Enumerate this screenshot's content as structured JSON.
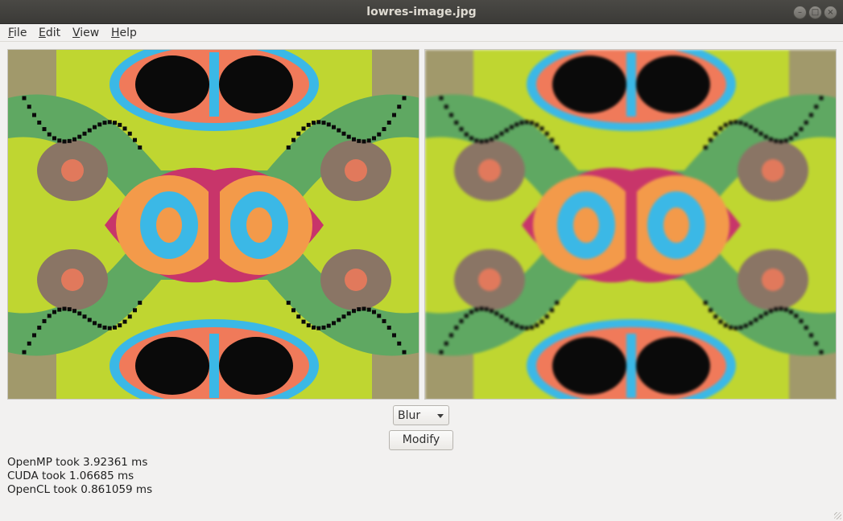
{
  "window": {
    "title": "lowres-image.jpg"
  },
  "menu": {
    "file": {
      "mnemonic": "F",
      "rest": "ile"
    },
    "edit": {
      "mnemonic": "E",
      "rest": "dit"
    },
    "view": {
      "mnemonic": "V",
      "rest": "iew"
    },
    "help": {
      "mnemonic": "H",
      "rest": "elp"
    }
  },
  "filter_select": {
    "value": "Blur"
  },
  "modify_button": {
    "label": "Modify"
  },
  "status": {
    "openmp": "OpenMP took 3.92361 ms",
    "cuda": "CUDA took 1.06685 ms",
    "opencl": "OpenCL took 0.861059 ms"
  },
  "colors": {
    "lime": "#bfd631",
    "green": "#5fa862",
    "orange": "#f39a4a",
    "cyan": "#3bb8e6",
    "magenta": "#c8356a",
    "brown": "#8a7565",
    "black": "#0a0a0a",
    "salmon": "#f07a5a"
  }
}
